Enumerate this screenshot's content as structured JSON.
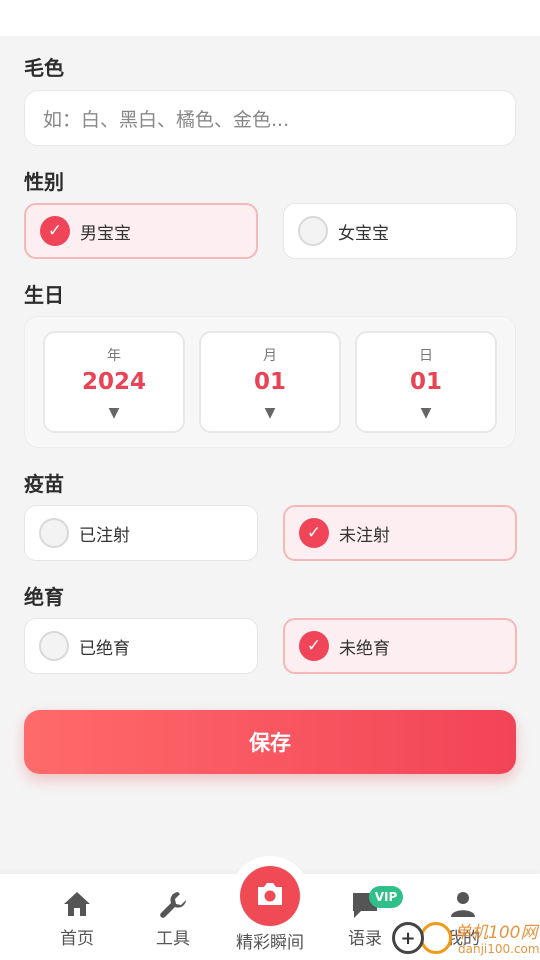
{
  "sections": {
    "coat": "毛色",
    "gender": "性别",
    "birthday": "生日",
    "vaccine": "疫苗",
    "neuter": "绝育"
  },
  "coat_input": {
    "placeholder": "如：白、黑白、橘色、金色..."
  },
  "gender": {
    "options": [
      "男宝宝",
      "女宝宝"
    ],
    "selected": "男宝宝"
  },
  "birthday": {
    "year_label": "年",
    "year": "2024",
    "month_label": "月",
    "month": "01",
    "day_label": "日",
    "day": "01",
    "arrow": "▼"
  },
  "vaccine": {
    "options": [
      "已注射",
      "未注射"
    ],
    "selected": "未注射"
  },
  "neuter": {
    "options": [
      "已绝育",
      "未绝育"
    ],
    "selected": "未绝育"
  },
  "check_glyph": "✓",
  "save_label": "保存",
  "tabbar": {
    "home": "首页",
    "tools": "工具",
    "moments": "精彩瞬间",
    "quotes": "语录",
    "vip": "VIP",
    "mine": "我的"
  },
  "watermark": {
    "brand": "单机100网",
    "url": "danji100.com",
    "plus": "+"
  },
  "colors": {
    "accent": "#f04458",
    "selected_bg": "#fdeef1",
    "vip": "#2fc08a"
  },
  "icons": [
    "home-icon",
    "wrench-icon",
    "camera-icon",
    "chat-icon",
    "user-icon"
  ]
}
